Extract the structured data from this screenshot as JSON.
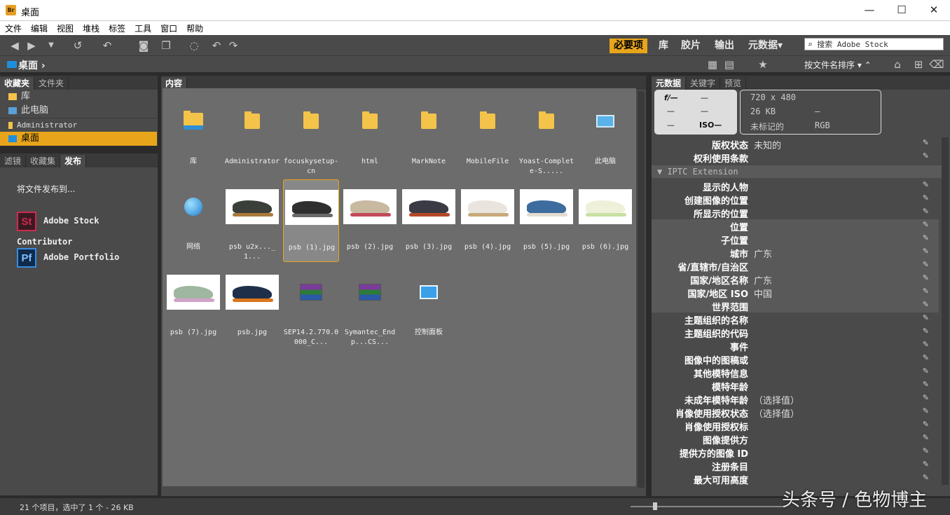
{
  "window": {
    "title": "桌面",
    "app_icon": "Br",
    "minimize": "—",
    "maximize": "☐",
    "close": "✕"
  },
  "menu": [
    "文件",
    "编辑",
    "视图",
    "堆栈",
    "标签",
    "工具",
    "窗口",
    "帮助"
  ],
  "workspaces": [
    "必要项",
    "库",
    "胶片",
    "输出",
    "元数据"
  ],
  "search": {
    "placeholder": "搜索 Adobe Stock"
  },
  "path": {
    "current": "桌面"
  },
  "sort": {
    "label": "按文件名排序"
  },
  "left": {
    "tabs": [
      "收藏夹",
      "文件夹"
    ],
    "favorites": [
      "库",
      "此电脑",
      "Administrator",
      "桌面"
    ],
    "tabs2": [
      "滤镜",
      "收藏集",
      "发布"
    ],
    "publish_prompt": "将文件发布到...",
    "publish_targets": [
      {
        "logo": "St",
        "name": "Adobe Stock Contributor",
        "color": "#cd2a4d"
      },
      {
        "logo": "Pf",
        "name": "Adobe Portfolio",
        "color": "#1c5fa8"
      }
    ]
  },
  "content": {
    "tab": "内容",
    "items": [
      {
        "name": "库",
        "type": "lib"
      },
      {
        "name": "Administrator",
        "type": "folder"
      },
      {
        "name": "focuskysetup-cn",
        "type": "folder"
      },
      {
        "name": "html",
        "type": "folder"
      },
      {
        "name": "MarkNote",
        "type": "folder"
      },
      {
        "name": "MobileFile",
        "type": "folder"
      },
      {
        "name": "Yoast-Complete-S.....",
        "type": "folder"
      },
      {
        "name": "此电脑",
        "type": "pc"
      },
      {
        "name": "网络",
        "type": "net"
      },
      {
        "name": "psb u2x..._1...",
        "type": "shoe",
        "c1": "#3b3f3a",
        "c2": "#a87b3a"
      },
      {
        "name": "psb (1).jpg",
        "type": "shoe",
        "c1": "#2f2f30",
        "c2": "#6a6a6a",
        "selected": true
      },
      {
        "name": "psb (2).jpg",
        "type": "shoe",
        "c1": "#c8b9a1",
        "c2": "#c24a5b"
      },
      {
        "name": "psb (3).jpg",
        "type": "shoe",
        "c1": "#3a3b44",
        "c2": "#b5482a"
      },
      {
        "name": "psb (4).jpg",
        "type": "shoe",
        "c1": "#e9e5de",
        "c2": "#c7a97a"
      },
      {
        "name": "psb (5).jpg",
        "type": "shoe",
        "c1": "#3d6c9e",
        "c2": "#e2dccf"
      },
      {
        "name": "psb (6).jpg",
        "type": "shoe",
        "c1": "#eef0d9",
        "c2": "#c8e0a4"
      },
      {
        "name": "psb (7).jpg",
        "type": "shoe",
        "c1": "#9fb7a0",
        "c2": "#d1a2c8"
      },
      {
        "name": "psb.jpg",
        "type": "shoe",
        "c1": "#1f2f4a",
        "c2": "#d8761e"
      },
      {
        "name": "SEP14.2.770.0000_C...",
        "type": "rar"
      },
      {
        "name": "Symantec_Endp...CS...",
        "type": "rar"
      },
      {
        "name": "控制面板",
        "type": "cp"
      }
    ]
  },
  "meta": {
    "tabs": [
      "元数据",
      "关键字",
      "预览"
    ],
    "summary_left": [
      "f/—",
      "—",
      "—",
      "—",
      "—",
      "ISO—"
    ],
    "summary_right": [
      "720 x 480",
      "26 KB",
      "—",
      "未标记的",
      "RGB"
    ],
    "section": "IPTC Extension",
    "top_rows": [
      {
        "label": "版权状态",
        "value": "未知的"
      },
      {
        "label": "权利使用条款",
        "value": ""
      }
    ],
    "rows": [
      {
        "label": "显示的人物",
        "value": ""
      },
      {
        "label": "创建图像的位置",
        "value": ""
      },
      {
        "label": "所显示的位置",
        "value": ""
      },
      {
        "label": "位置",
        "value": ""
      },
      {
        "label": "子位置",
        "value": ""
      },
      {
        "label": "城市",
        "value": "广东"
      },
      {
        "label": "省/直辖市/自治区",
        "value": ""
      },
      {
        "label": "国家/地区名称",
        "value": "广东"
      },
      {
        "label": "国家/地区 ISO",
        "value": "中国"
      },
      {
        "label": "世界范围",
        "value": ""
      },
      {
        "label": "主题组织的名称",
        "value": ""
      },
      {
        "label": "主题组织的代码",
        "value": ""
      },
      {
        "label": "事件",
        "value": ""
      },
      {
        "label": "图像中的图稿或",
        "value": ""
      },
      {
        "label": "其他模特信息",
        "value": ""
      },
      {
        "label": "模特年龄",
        "value": ""
      },
      {
        "label": "未成年模特年龄",
        "value": "（选择值）"
      },
      {
        "label": "肖像使用授权状态",
        "value": "（选择值）"
      },
      {
        "label": "肖像使用授权标",
        "value": ""
      },
      {
        "label": "图像提供方",
        "value": ""
      },
      {
        "label": "提供方的图像 ID",
        "value": ""
      },
      {
        "label": "注册条目",
        "value": ""
      },
      {
        "label": "最大可用高度",
        "value": ""
      }
    ]
  },
  "status": {
    "text": "21 个项目，选中了 1 个 - 26 KB"
  },
  "watermark": "头条号 / 色物博主"
}
